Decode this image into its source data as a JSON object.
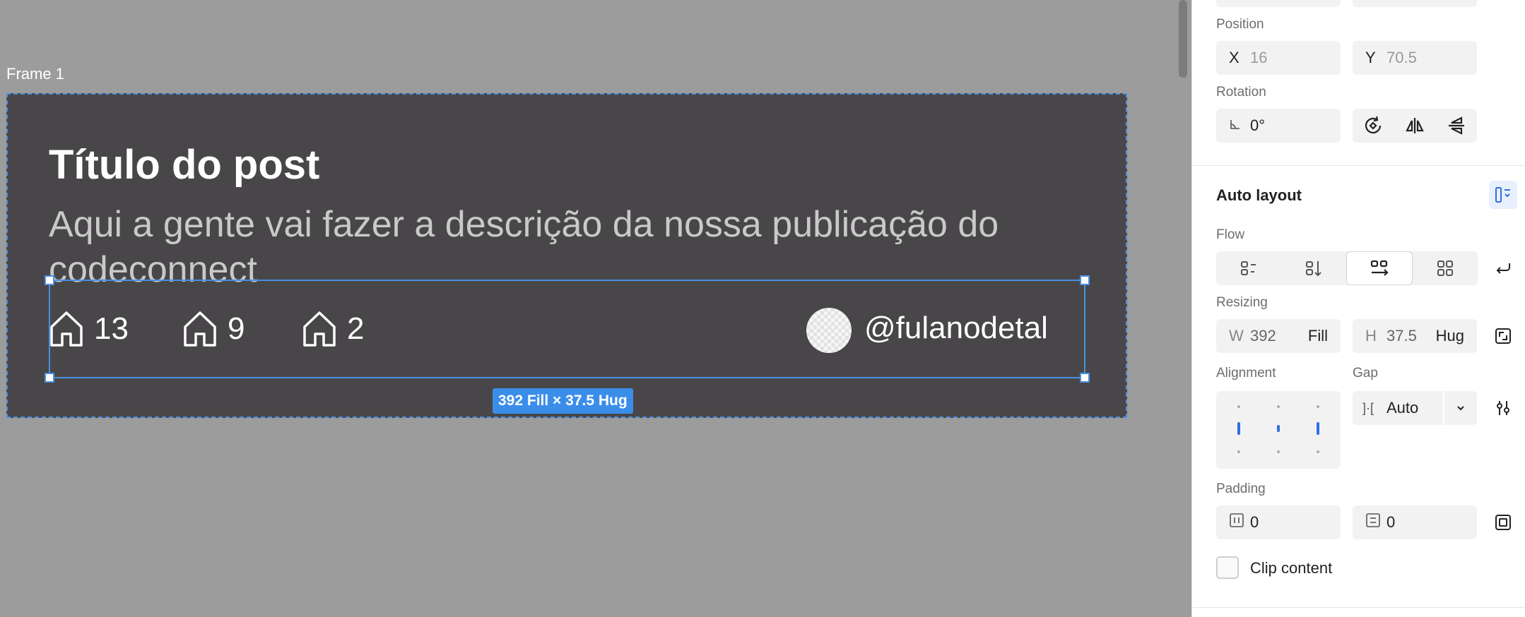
{
  "canvas": {
    "frame_label": "Frame 1",
    "post": {
      "title": "Título do post",
      "description": "Aqui a gente vai fazer a descrição da nossa publicação do codeconnect",
      "stats": [
        {
          "icon": "home-icon",
          "value": "13"
        },
        {
          "icon": "home-icon",
          "value": "9"
        },
        {
          "icon": "home-icon",
          "value": "2"
        }
      ],
      "username": "@fulanodetal"
    },
    "selection_badge": "392 Fill × 37.5 Hug"
  },
  "panel": {
    "position": {
      "label": "Position",
      "x_prefix": "X",
      "x_value": "16",
      "y_prefix": "Y",
      "y_value": "70.5"
    },
    "rotation": {
      "label": "Rotation",
      "value": "0°"
    },
    "auto_layout": {
      "title": "Auto layout",
      "flow_label": "Flow",
      "flow_options": [
        "vertical-layout-icon",
        "vertical-arrow-icon",
        "horizontal-wrap-icon",
        "grid-icon"
      ],
      "flow_active_index": 2,
      "resizing_label": "Resizing",
      "width": {
        "prefix": "W",
        "value": "392",
        "mode": "Fill"
      },
      "height": {
        "prefix": "H",
        "value": "37.5",
        "mode": "Hug"
      },
      "alignment_label": "Alignment",
      "gap_label": "Gap",
      "gap_prefix": "]·[",
      "gap_value": "Auto",
      "padding_label": "Padding",
      "padding_horizontal": "0",
      "padding_vertical": "0",
      "clip_content_label": "Clip content",
      "clip_content_checked": false
    }
  },
  "colors": {
    "canvas_bg": "#9c9c9c",
    "frame_bg": "#484648",
    "selection": "#4a90e2",
    "badge": "#3b8dea",
    "accent": "#2f6fe0"
  }
}
